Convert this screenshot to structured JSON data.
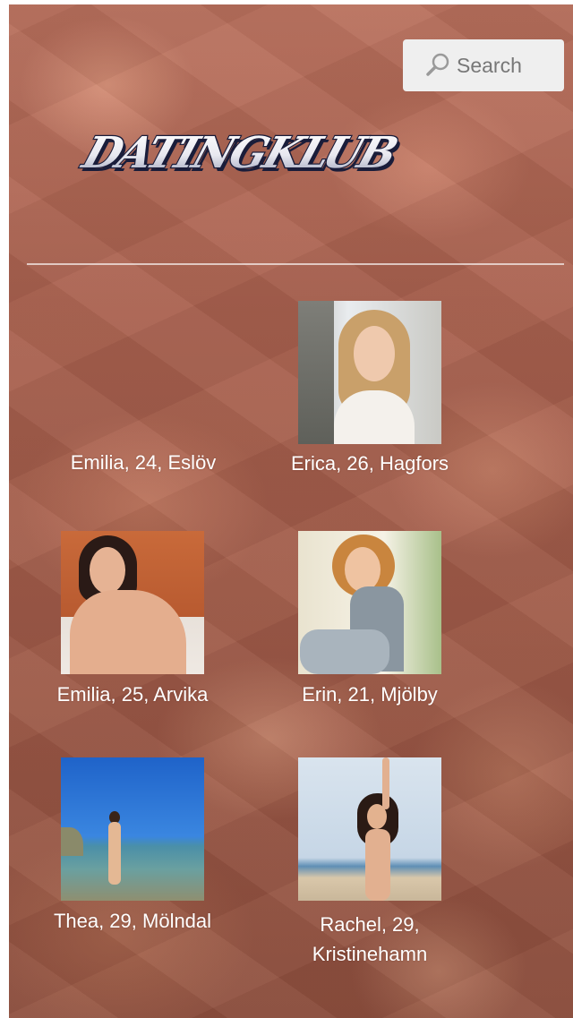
{
  "header": {
    "search": {
      "label": "Search",
      "icon": "search-icon"
    },
    "logo": {
      "text": "DATINGKLUB"
    }
  },
  "profiles": [
    {
      "caption": "Emilia, 24, Eslöv",
      "photo": "none"
    },
    {
      "caption": "Erica, 26, Hagfors",
      "photo": "portrait"
    },
    {
      "caption": "Emilia, 25, Arvika",
      "photo": "portrait"
    },
    {
      "caption": "Erin, 21, Mjölby",
      "photo": "portrait"
    },
    {
      "caption": "Thea, 29, Mölndal",
      "photo": "portrait"
    },
    {
      "caption_line1": "Rachel, 29,",
      "caption_line2": "Kristinehamn",
      "photo": "portrait"
    }
  ],
  "colors": {
    "background": "#a8604e",
    "search_bg": "#efefef",
    "caption_text": "#ffffff",
    "divider": "#f2d9d0"
  }
}
